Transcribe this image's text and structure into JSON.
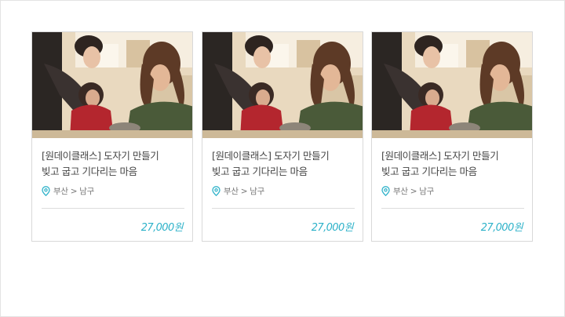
{
  "cards": [
    {
      "image_alt": "pottery class photo",
      "title_line1": "[원데이클래스] 도자기 만들기",
      "title_line2": "빚고 굽고 기다리는 마음",
      "location": "부산 > 남구",
      "location_icon": "map-pin-icon",
      "price": "27,000원"
    },
    {
      "image_alt": "pottery class photo",
      "title_line1": "[원데이클래스] 도자기 만들기",
      "title_line2": "빚고 굽고 기다리는 마음",
      "location": "부산 > 남구",
      "location_icon": "map-pin-icon",
      "price": "27,000원"
    },
    {
      "image_alt": "pottery class photo",
      "title_line1": "[원데이클래스] 도자기 만들기",
      "title_line2": "빚고 굽고 기다리는 마음",
      "location": "부산 > 남구",
      "location_icon": "map-pin-icon",
      "price": "27,000원"
    }
  ],
  "colors": {
    "accent": "#2eb2c9",
    "title_text": "#444444",
    "meta_text": "#777777"
  }
}
